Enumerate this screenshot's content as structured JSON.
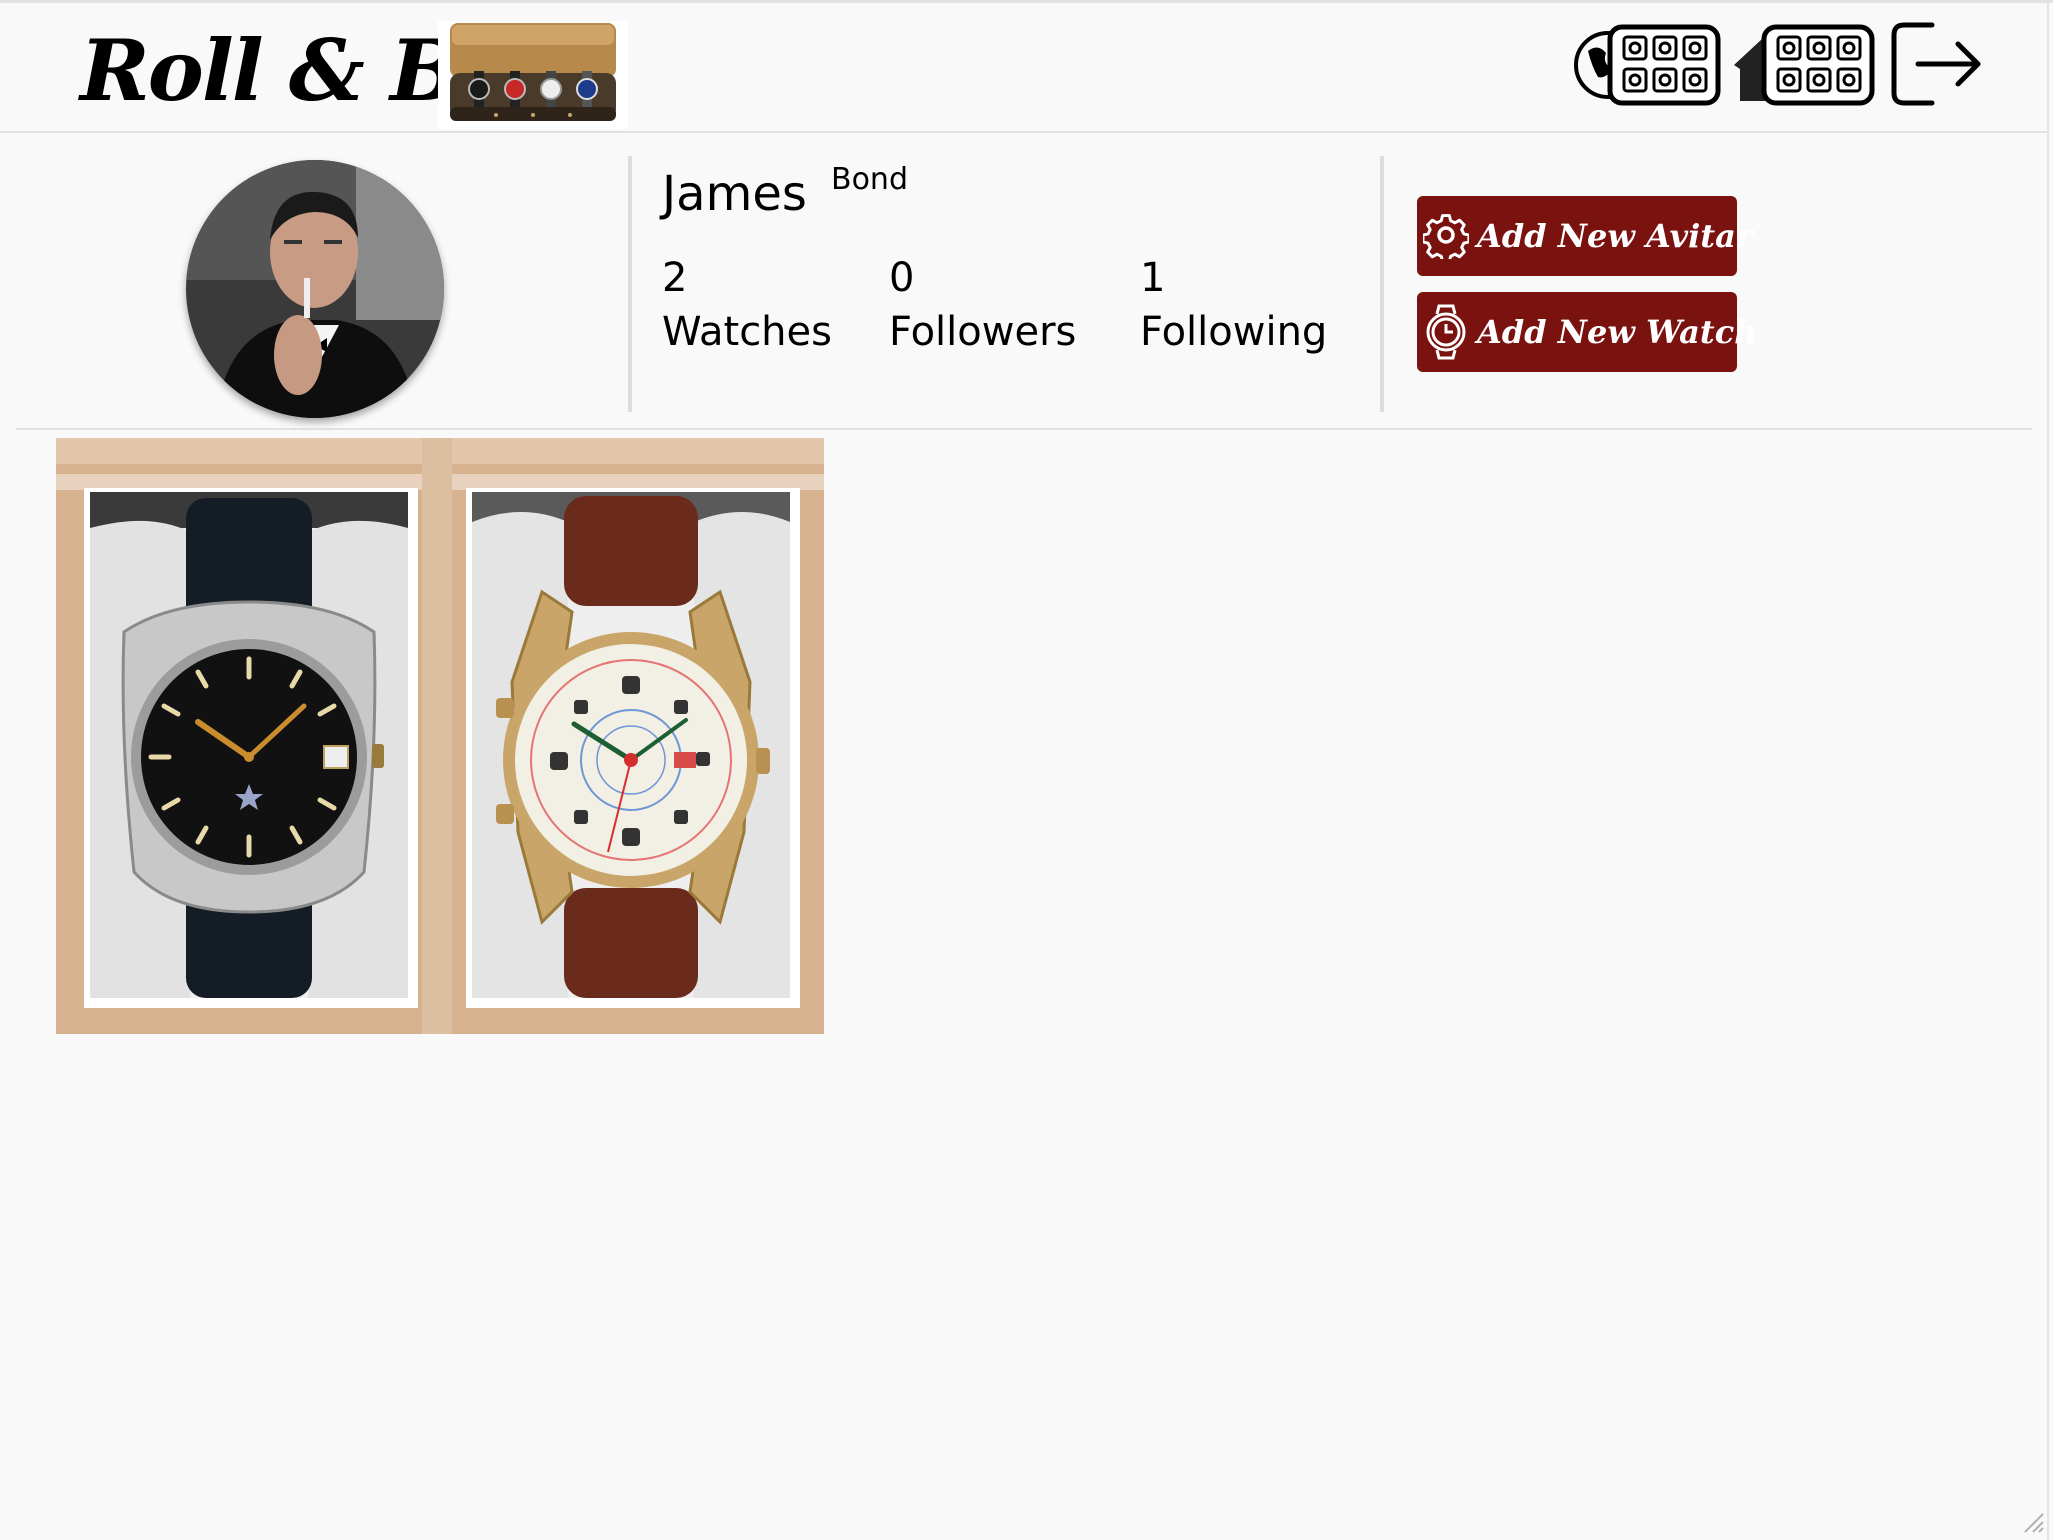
{
  "header": {
    "brand": "Roll & Box",
    "logo_icon": "watch-roll-logo",
    "nav": [
      {
        "name": "explore-boxes-button",
        "icon": "globe-watchbox-icon"
      },
      {
        "name": "my-box-button",
        "icon": "home-watchbox-icon"
      },
      {
        "name": "logout-button",
        "icon": "logout-icon"
      }
    ]
  },
  "profile": {
    "first_name": "James",
    "last_name": "Bond",
    "stats": [
      {
        "value": "2",
        "label": "Watches"
      },
      {
        "value": "0",
        "label": "Followers"
      },
      {
        "value": "1",
        "label": "Following"
      }
    ],
    "buttons": {
      "add_avatar": "Add New Avitar",
      "add_watch": "Add New Watch"
    }
  },
  "watches": [
    {
      "name": "watch-black-dial",
      "dial_color": "#111111",
      "strap_color": "#141c26",
      "case_color": "#c8c8c8"
    },
    {
      "name": "watch-white-dial",
      "dial_color": "#f2efe4",
      "strap_color": "#6b2b1c",
      "case_color": "#c9a56a"
    }
  ],
  "colors": {
    "accent": "#7a1210",
    "background": "#f9f9f9",
    "box_wood": "#d7b28f"
  }
}
